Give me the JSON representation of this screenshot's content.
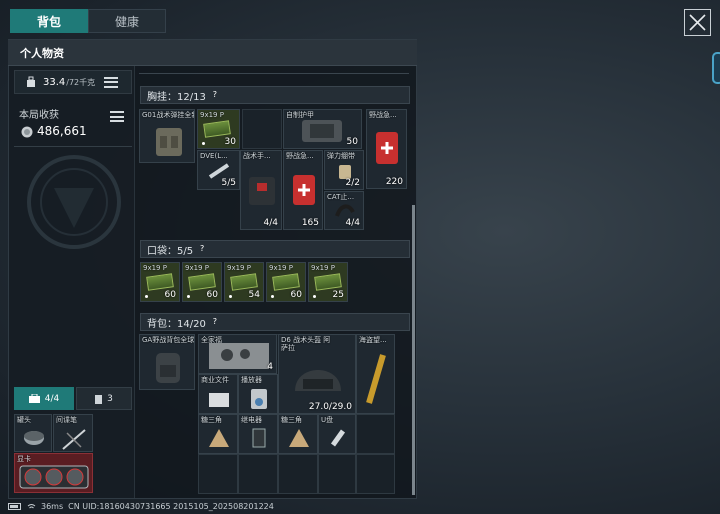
{
  "tabs": {
    "backpack": "背包",
    "health": "健康"
  },
  "panel": {
    "title": "个人物资"
  },
  "weight": {
    "value": "33.4",
    "max": "/72千克"
  },
  "earnings": {
    "label": "本局收获",
    "value": "486,661"
  },
  "bottom_tabs": {
    "equip_count": "4/4",
    "other_count": "3"
  },
  "equip_items": [
    {
      "name": "罐头"
    },
    {
      "name": "间谍笔"
    },
    {
      "name": "显卡"
    }
  ],
  "chest_rig": {
    "label": "胸挂：12/13",
    "items": [
      {
        "name": "G01战术弹挂全新力量"
      },
      {
        "name": "9x19 P",
        "count": "30"
      },
      {
        "name": "自制护甲",
        "count": "50"
      },
      {
        "name": "野战急...",
        "count": "220"
      },
      {
        "name": "DVE(L...",
        "count": "5/5"
      },
      {
        "name": "战术手...",
        "count": "4/4"
      },
      {
        "name": "野战急...",
        "count": "165"
      },
      {
        "name": "弹力绷带",
        "count": "2/2"
      },
      {
        "name": "CAT止...",
        "count": "4/4"
      }
    ]
  },
  "pockets": {
    "label": "口袋：5/5",
    "items": [
      {
        "name": "9x19 P",
        "count": "60"
      },
      {
        "name": "9x19 P",
        "count": "60"
      },
      {
        "name": "9x19 P",
        "count": "54"
      },
      {
        "name": "9x19 P",
        "count": "60"
      },
      {
        "name": "9x19 P",
        "count": "25"
      }
    ]
  },
  "backpack": {
    "label": "背包：14/20",
    "items": [
      {
        "name": "GA野战背包全球"
      },
      {
        "name": "全家福",
        "count": "4"
      },
      {
        "name": "D6 战术头盔 阿萨拉",
        "count": "27.0/29.0"
      },
      {
        "name": "海盗望..."
      },
      {
        "name": "商业文件"
      },
      {
        "name": "播放器"
      },
      {
        "name": "糖三角"
      },
      {
        "name": "继电器"
      },
      {
        "name": "糖三角"
      },
      {
        "name": "U盘"
      }
    ]
  },
  "status": {
    "ping": "36ms",
    "uid": "CN UID:18160430731665 2015105_202508201224"
  }
}
